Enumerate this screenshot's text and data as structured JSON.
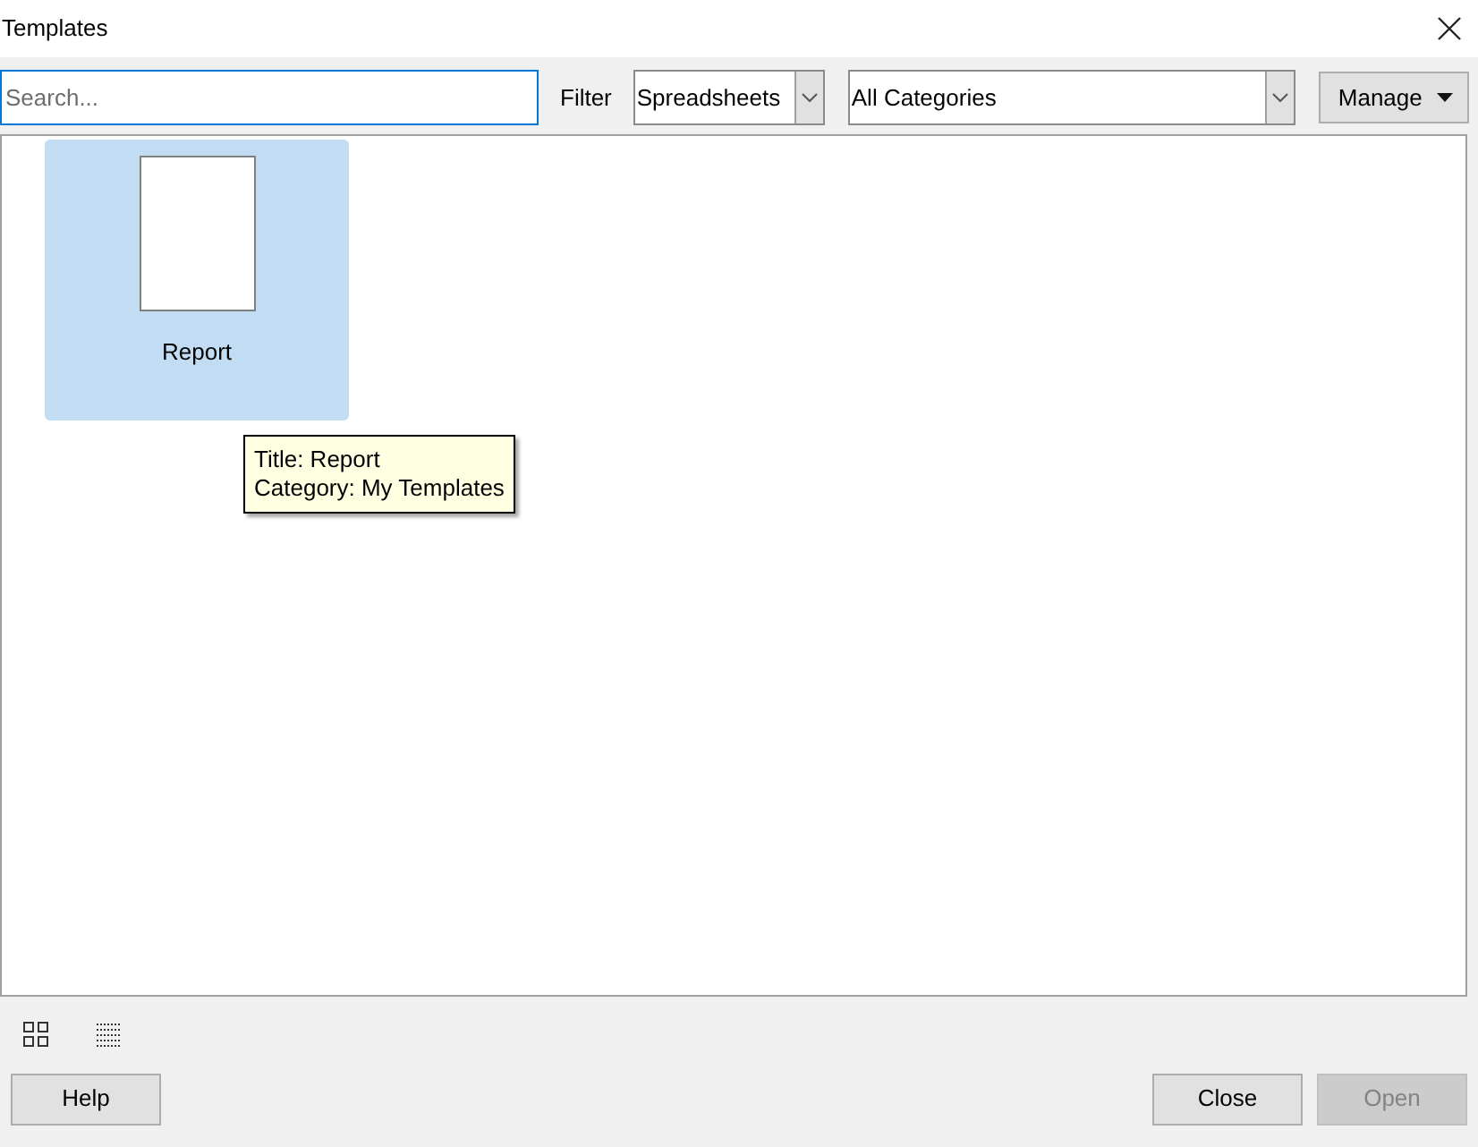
{
  "window": {
    "title": "Templates"
  },
  "search": {
    "placeholder": "Search..."
  },
  "filter": {
    "label": "Filter",
    "document_type": "Spreadsheets",
    "category": "All Categories"
  },
  "manage_button": "Manage",
  "templates": [
    {
      "name": "Report",
      "selected": true
    }
  ],
  "tooltip": {
    "lines": [
      "Title: Report",
      "Category: My Templates"
    ]
  },
  "buttons": [
    {
      "label": "Help",
      "disabled": false
    },
    {
      "label": "Close",
      "disabled": false
    },
    {
      "label": "Open",
      "disabled": true
    }
  ]
}
